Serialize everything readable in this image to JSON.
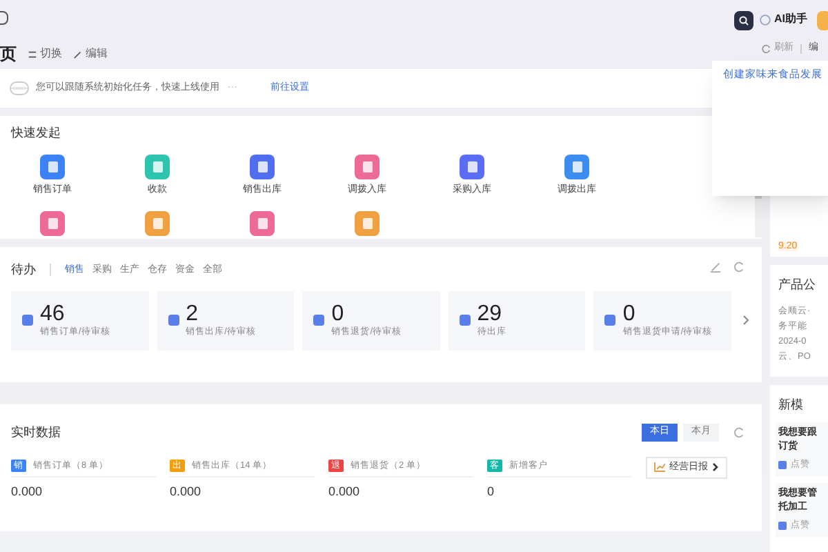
{
  "header": {
    "page_title": "页",
    "actions": [
      "切换",
      "编辑"
    ],
    "ai_label": "AI助手",
    "toolbar": [
      "刷新",
      "编"
    ]
  },
  "dropdown": {
    "item": "创建家味来食品发展"
  },
  "notice": {
    "text": "您可以跟随系统初始化任务，快速上线使用",
    "more": "···",
    "link": "前往设置"
  },
  "quick_start": {
    "title": "快速发起",
    "items": [
      {
        "label": "销售订单",
        "color": "#3b82f6"
      },
      {
        "label": "收款",
        "color": "#2dc5b0"
      },
      {
        "label": "销售出库",
        "color": "#4f6ef0"
      },
      {
        "label": "调拨入库",
        "color": "#ec6a93"
      },
      {
        "label": "采购入库",
        "color": "#5b6cf5"
      },
      {
        "label": "调拨出库",
        "color": "#3b8ef0"
      },
      {
        "color": "#ec6a93"
      },
      {
        "color": "#f0a040"
      },
      {
        "color": "#ec6a93"
      },
      {
        "color": "#f0a040"
      }
    ]
  },
  "todo": {
    "title": "待办",
    "tabs": [
      {
        "label": "销售",
        "selected": true
      },
      {
        "label": "采购",
        "selected": false
      },
      {
        "label": "生产",
        "selected": false
      },
      {
        "label": "仓存",
        "selected": false
      },
      {
        "label": "资金",
        "selected": false
      },
      {
        "label": "全部",
        "selected": false
      }
    ],
    "cards": [
      {
        "count": "46",
        "label": "销售订单/待审核"
      },
      {
        "count": "2",
        "label": "销售出库/待审核"
      },
      {
        "count": "0",
        "label": "销售退货/待审核"
      },
      {
        "count": "29",
        "label": "待出库"
      },
      {
        "count": "0",
        "label": "销售退货申请/待审核"
      }
    ]
  },
  "realtime": {
    "title": "实时数据",
    "periods": [
      {
        "label": "本日",
        "selected": true
      },
      {
        "label": "本月",
        "selected": false
      }
    ],
    "metrics": [
      {
        "badge": "销",
        "label": "销售订单（8 单）",
        "value": "0.000",
        "color": "#3b82f6"
      },
      {
        "badge": "出",
        "label": "销售出库（14 单）",
        "value": "0.000",
        "color": "#f59e0b"
      },
      {
        "badge": "退",
        "label": "销售退货（2 单）",
        "value": "0.000",
        "color": "#ef4444"
      },
      {
        "badge": "客",
        "label": "新增客户",
        "value": "0",
        "color": "#14b8a6"
      }
    ],
    "report_button": "经营日报"
  },
  "sidebar": {
    "price": "9.20",
    "announcement": {
      "title": "产品公",
      "lines": [
        "会顺云·",
        "务平能",
        "2024-0",
        "云、PO"
      ]
    },
    "section_title": "新模",
    "cards": [
      {
        "lines": [
          "我想要跟",
          "订货"
        ],
        "action": "点赞"
      },
      {
        "lines": [
          "我想要管",
          "托加工"
        ],
        "action": "点赞"
      }
    ]
  }
}
